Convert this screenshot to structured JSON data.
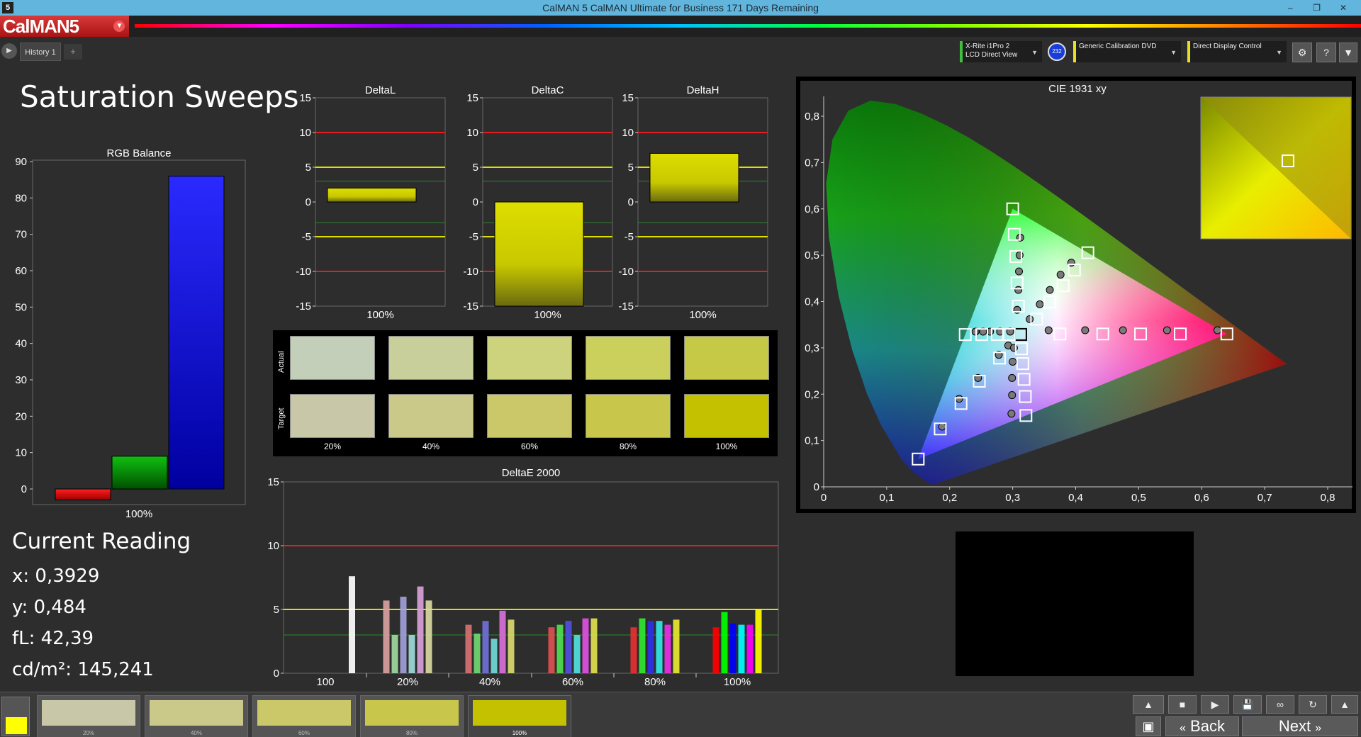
{
  "window": {
    "title": "CalMAN 5 CalMAN Ultimate for Business 171 Days Remaining",
    "app_icon": "5",
    "controls": [
      "–",
      "❐",
      "✕"
    ]
  },
  "logo": {
    "text": "CalMAN5",
    "menu_icon": "dropdown-icon"
  },
  "tabs": {
    "history_label": "History 1",
    "add_label": "+"
  },
  "devices": [
    {
      "line1": "X-Rite i1Pro 2",
      "line2": "LCD Direct View",
      "accent": "#3fbf3f"
    },
    {
      "line1": "Generic Calibration DVD",
      "line2": "",
      "accent": "#e8e020"
    },
    {
      "line1": "Direct Display Control",
      "line2": "",
      "accent": "#e8e020"
    }
  ],
  "device_badge": "232",
  "toolbar_icons": [
    "gear-icon",
    "help-icon",
    "chevron-down-icon"
  ],
  "page_title": "Saturation Sweeps",
  "current_reading": {
    "heading": "Current Reading",
    "x": "x: 0,3929",
    "y": "y: 0,484",
    "fl": "fL: 42,39",
    "cdm2": "cd/m²: 145,241"
  },
  "patches": {
    "row_labels": [
      "Actual",
      "Target"
    ],
    "labels": [
      "20%",
      "40%",
      "60%",
      "80%",
      "100%"
    ],
    "actual_colors": [
      "#c3cfb9",
      "#c8cf9a",
      "#cdd27c",
      "#cbd05d",
      "#c6c945"
    ],
    "target_colors": [
      "#c8c8a8",
      "#cbc98a",
      "#cbc86a",
      "#c9c64c",
      "#c4c200"
    ]
  },
  "bottom": {
    "current_color": "#ffff00",
    "swatches": [
      {
        "label": "20%",
        "color": "#c8c8a8"
      },
      {
        "label": "40%",
        "color": "#cbc98a"
      },
      {
        "label": "60%",
        "color": "#cbc86a"
      },
      {
        "label": "80%",
        "color": "#c9c64c"
      },
      {
        "label": "100%",
        "color": "#c4c200"
      }
    ],
    "back_label": "Back",
    "next_label": "Next",
    "control_icons": [
      "stop-icon",
      "play-icon",
      "save-icon",
      "loop-icon",
      "refresh-icon"
    ]
  },
  "chart_data": [
    {
      "type": "bar",
      "title": "RGB Balance",
      "categories": [
        "100%"
      ],
      "series": [
        {
          "color": "#ff0000",
          "values": [
            -3
          ]
        },
        {
          "color": "#00a000",
          "values": [
            9
          ]
        },
        {
          "color": "#2020ff",
          "values": [
            86
          ]
        }
      ],
      "ylim": [
        -3,
        90
      ],
      "yticks": [
        0,
        10,
        20,
        30,
        40,
        50,
        60,
        70,
        80,
        90
      ]
    },
    {
      "type": "bar",
      "title": "DeltaL",
      "categories": [
        "100%"
      ],
      "values": [
        2
      ],
      "ylim": [
        -15,
        15
      ],
      "yticks": [
        15,
        10,
        5,
        0,
        -5,
        -10,
        -15
      ]
    },
    {
      "type": "bar",
      "title": "DeltaC",
      "categories": [
        "100%"
      ],
      "values": [
        -15
      ],
      "ylim": [
        -15,
        15
      ],
      "yticks": [
        15,
        10,
        5,
        0,
        -5,
        -10,
        -15
      ]
    },
    {
      "type": "bar",
      "title": "DeltaH",
      "categories": [
        "100%"
      ],
      "values": [
        7
      ],
      "ylim": [
        -15,
        15
      ],
      "yticks": [
        15,
        10,
        5,
        0,
        -5,
        -10,
        -15
      ]
    },
    {
      "type": "bar",
      "title": "DeltaE 2000",
      "categories": [
        "100",
        "20%",
        "40%",
        "60%",
        "80%",
        "100%"
      ],
      "groups": [
        [
          {
            "v": 7.6,
            "c": "#ffffff"
          }
        ],
        [
          {
            "v": 5.7,
            "c": "#d9a0a0"
          },
          {
            "v": 3.0,
            "c": "#a0d9a0"
          },
          {
            "v": 6.0,
            "c": "#a0a0d9"
          },
          {
            "v": 3.0,
            "c": "#a0d9d9"
          },
          {
            "v": 6.8,
            "c": "#d9a0d9"
          },
          {
            "v": 5.7,
            "c": "#d9d9a0"
          }
        ],
        [
          {
            "v": 3.8,
            "c": "#d97070"
          },
          {
            "v": 3.1,
            "c": "#70d970"
          },
          {
            "v": 4.1,
            "c": "#7070d9"
          },
          {
            "v": 2.7,
            "c": "#70d9d9"
          },
          {
            "v": 4.9,
            "c": "#d970d9"
          },
          {
            "v": 4.2,
            "c": "#d9d970"
          }
        ],
        [
          {
            "v": 3.6,
            "c": "#e05050"
          },
          {
            "v": 3.8,
            "c": "#50e050"
          },
          {
            "v": 4.1,
            "c": "#5050e0"
          },
          {
            "v": 3.0,
            "c": "#50e0e0"
          },
          {
            "v": 4.3,
            "c": "#e050e0"
          },
          {
            "v": 4.3,
            "c": "#e0e050"
          }
        ],
        [
          {
            "v": 3.6,
            "c": "#e83030"
          },
          {
            "v": 4.3,
            "c": "#30e830"
          },
          {
            "v": 4.1,
            "c": "#3030e8"
          },
          {
            "v": 4.1,
            "c": "#30e8e8"
          },
          {
            "v": 3.8,
            "c": "#e830e8"
          },
          {
            "v": 4.2,
            "c": "#e8e830"
          }
        ],
        [
          {
            "v": 3.6,
            "c": "#ff0000"
          },
          {
            "v": 4.8,
            "c": "#00ff00"
          },
          {
            "v": 3.9,
            "c": "#0000ff"
          },
          {
            "v": 3.8,
            "c": "#00ffff"
          },
          {
            "v": 3.8,
            "c": "#ff00ff"
          },
          {
            "v": 5.0,
            "c": "#ffff00"
          }
        ]
      ],
      "ylim": [
        0,
        15
      ],
      "yticks": [
        0,
        5,
        10,
        15
      ],
      "thresholds": [
        10,
        5,
        3
      ]
    },
    {
      "type": "scatter",
      "title": "CIE 1931 xy",
      "xlim": [
        0,
        0.8
      ],
      "ylim": [
        0,
        0.85
      ],
      "xticks": [
        "0",
        "0,1",
        "0,2",
        "0,3",
        "0,4",
        "0,5",
        "0,6",
        "0,7",
        "0,8"
      ],
      "yticks": [
        "0",
        "0,1",
        "0,2",
        "0,3",
        "0,4",
        "0,5",
        "0,6",
        "0,7",
        "0,8"
      ],
      "gamut": [
        [
          0.64,
          0.33
        ],
        [
          0.3,
          0.6
        ],
        [
          0.15,
          0.06
        ]
      ],
      "targets": [
        [
          0.3127,
          0.329
        ],
        [
          0.3,
          0.6
        ],
        [
          0.3025,
          0.545
        ],
        [
          0.305,
          0.497
        ],
        [
          0.307,
          0.44
        ],
        [
          0.309,
          0.39
        ],
        [
          0.64,
          0.33
        ],
        [
          0.566,
          0.33
        ],
        [
          0.503,
          0.33
        ],
        [
          0.443,
          0.33
        ],
        [
          0.375,
          0.33
        ],
        [
          0.15,
          0.06
        ],
        [
          0.185,
          0.125
        ],
        [
          0.218,
          0.18
        ],
        [
          0.247,
          0.228
        ],
        [
          0.279,
          0.278
        ],
        [
          0.2247,
          0.3287
        ],
        [
          0.2509,
          0.3286
        ],
        [
          0.2755,
          0.3288
        ],
        [
          0.2946,
          0.3289
        ],
        [
          0.321,
          0.154
        ],
        [
          0.32,
          0.195
        ],
        [
          0.318,
          0.232
        ],
        [
          0.316,
          0.266
        ],
        [
          0.314,
          0.298
        ],
        [
          0.4193,
          0.5053
        ],
        [
          0.398,
          0.468
        ],
        [
          0.38,
          0.434
        ],
        [
          0.359,
          0.399
        ],
        [
          0.338,
          0.362
        ]
      ],
      "measured": [
        [
          0.312,
          0.538
        ],
        [
          0.311,
          0.5
        ],
        [
          0.31,
          0.465
        ],
        [
          0.309,
          0.425
        ],
        [
          0.307,
          0.382
        ],
        [
          0.625,
          0.338
        ],
        [
          0.545,
          0.338
        ],
        [
          0.475,
          0.338
        ],
        [
          0.415,
          0.338
        ],
        [
          0.357,
          0.338
        ],
        [
          0.188,
          0.13
        ],
        [
          0.215,
          0.19
        ],
        [
          0.245,
          0.235
        ],
        [
          0.278,
          0.285
        ],
        [
          0.293,
          0.305
        ],
        [
          0.241,
          0.335
        ],
        [
          0.253,
          0.335
        ],
        [
          0.264,
          0.335
        ],
        [
          0.28,
          0.335
        ],
        [
          0.296,
          0.335
        ],
        [
          0.298,
          0.158
        ],
        [
          0.299,
          0.198
        ],
        [
          0.299,
          0.235
        ],
        [
          0.3,
          0.27
        ],
        [
          0.302,
          0.3
        ],
        [
          0.393,
          0.484
        ],
        [
          0.376,
          0.458
        ],
        [
          0.359,
          0.425
        ],
        [
          0.343,
          0.394
        ],
        [
          0.327,
          0.362
        ]
      ],
      "measured_color": "#7a7a7a",
      "inset_marker": [
        0.58,
        0.45
      ]
    }
  ]
}
